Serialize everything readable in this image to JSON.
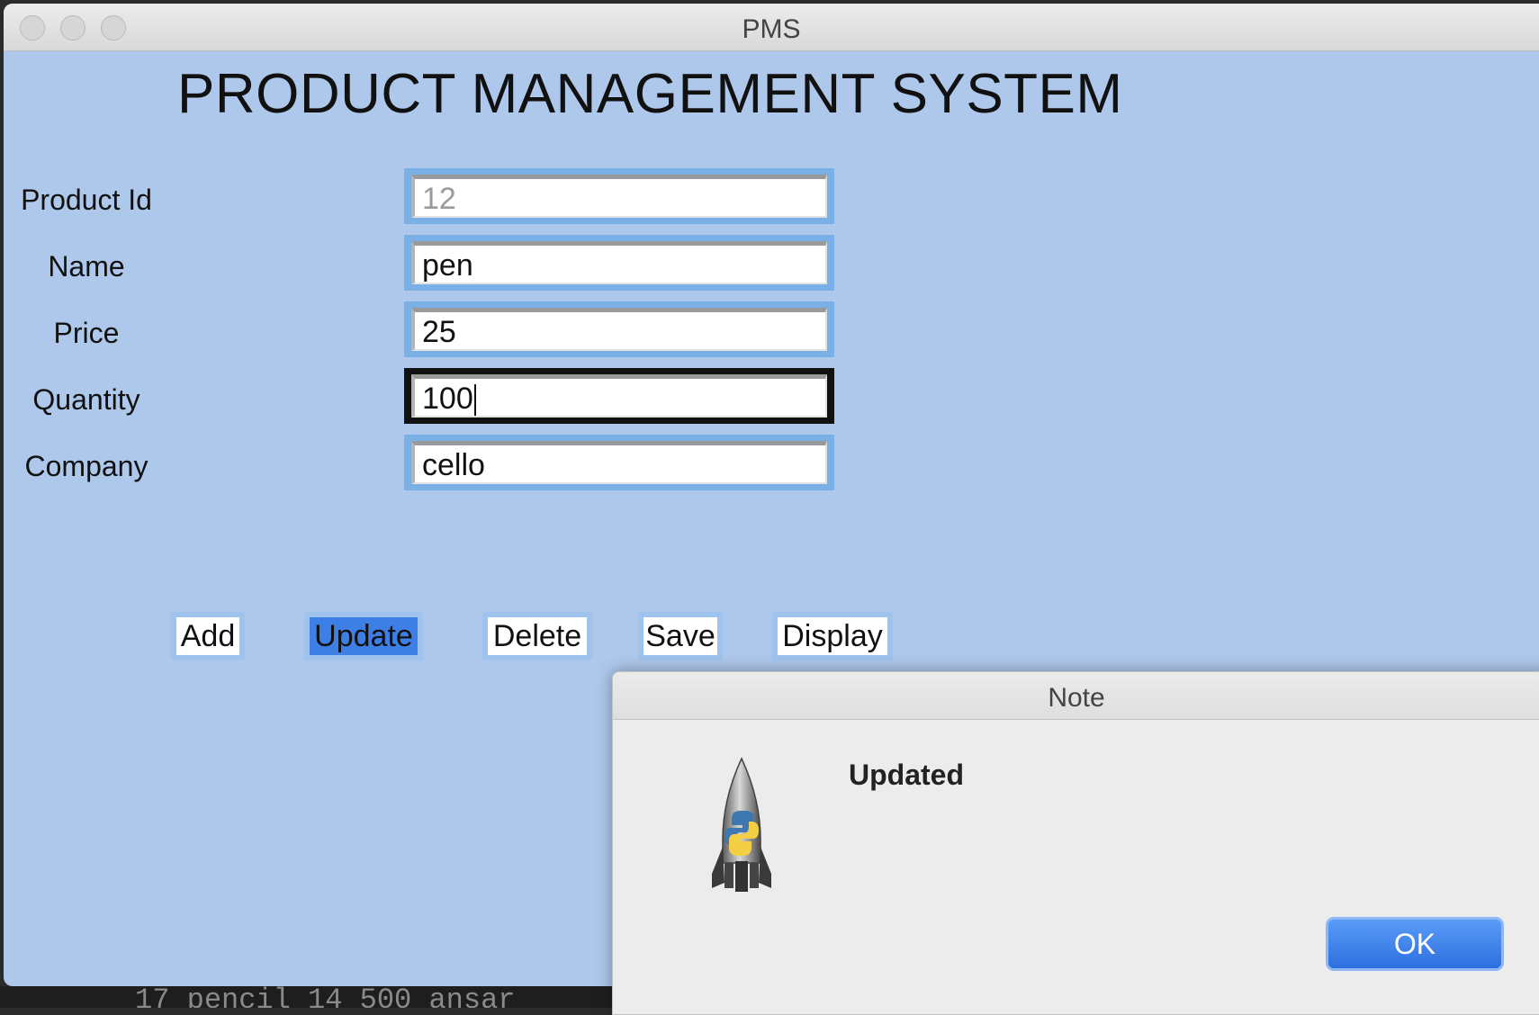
{
  "background": {
    "terminal_text": "17 pencil 14 500 ansar"
  },
  "window": {
    "title": "PMS",
    "app_title": "PRODUCT MANAGEMENT SYSTEM"
  },
  "form": {
    "product_id": {
      "label": "Product Id",
      "value": "12"
    },
    "name": {
      "label": "Name",
      "value": "pen"
    },
    "price": {
      "label": "Price",
      "value": "25"
    },
    "quantity": {
      "label": "Quantity",
      "value": "100"
    },
    "company": {
      "label": "Company",
      "value": "cello"
    }
  },
  "buttons": {
    "add": "Add",
    "update": "Update",
    "delete": "Delete",
    "save": "Save",
    "display": "Display"
  },
  "dialog": {
    "title": "Note",
    "message": "Updated",
    "ok_label": "OK",
    "icon": "python-rocket-icon"
  },
  "colors": {
    "window_bg": "#aec8ec",
    "active_button": "#3e7fe6",
    "ok_button": "#2e6fe0"
  }
}
